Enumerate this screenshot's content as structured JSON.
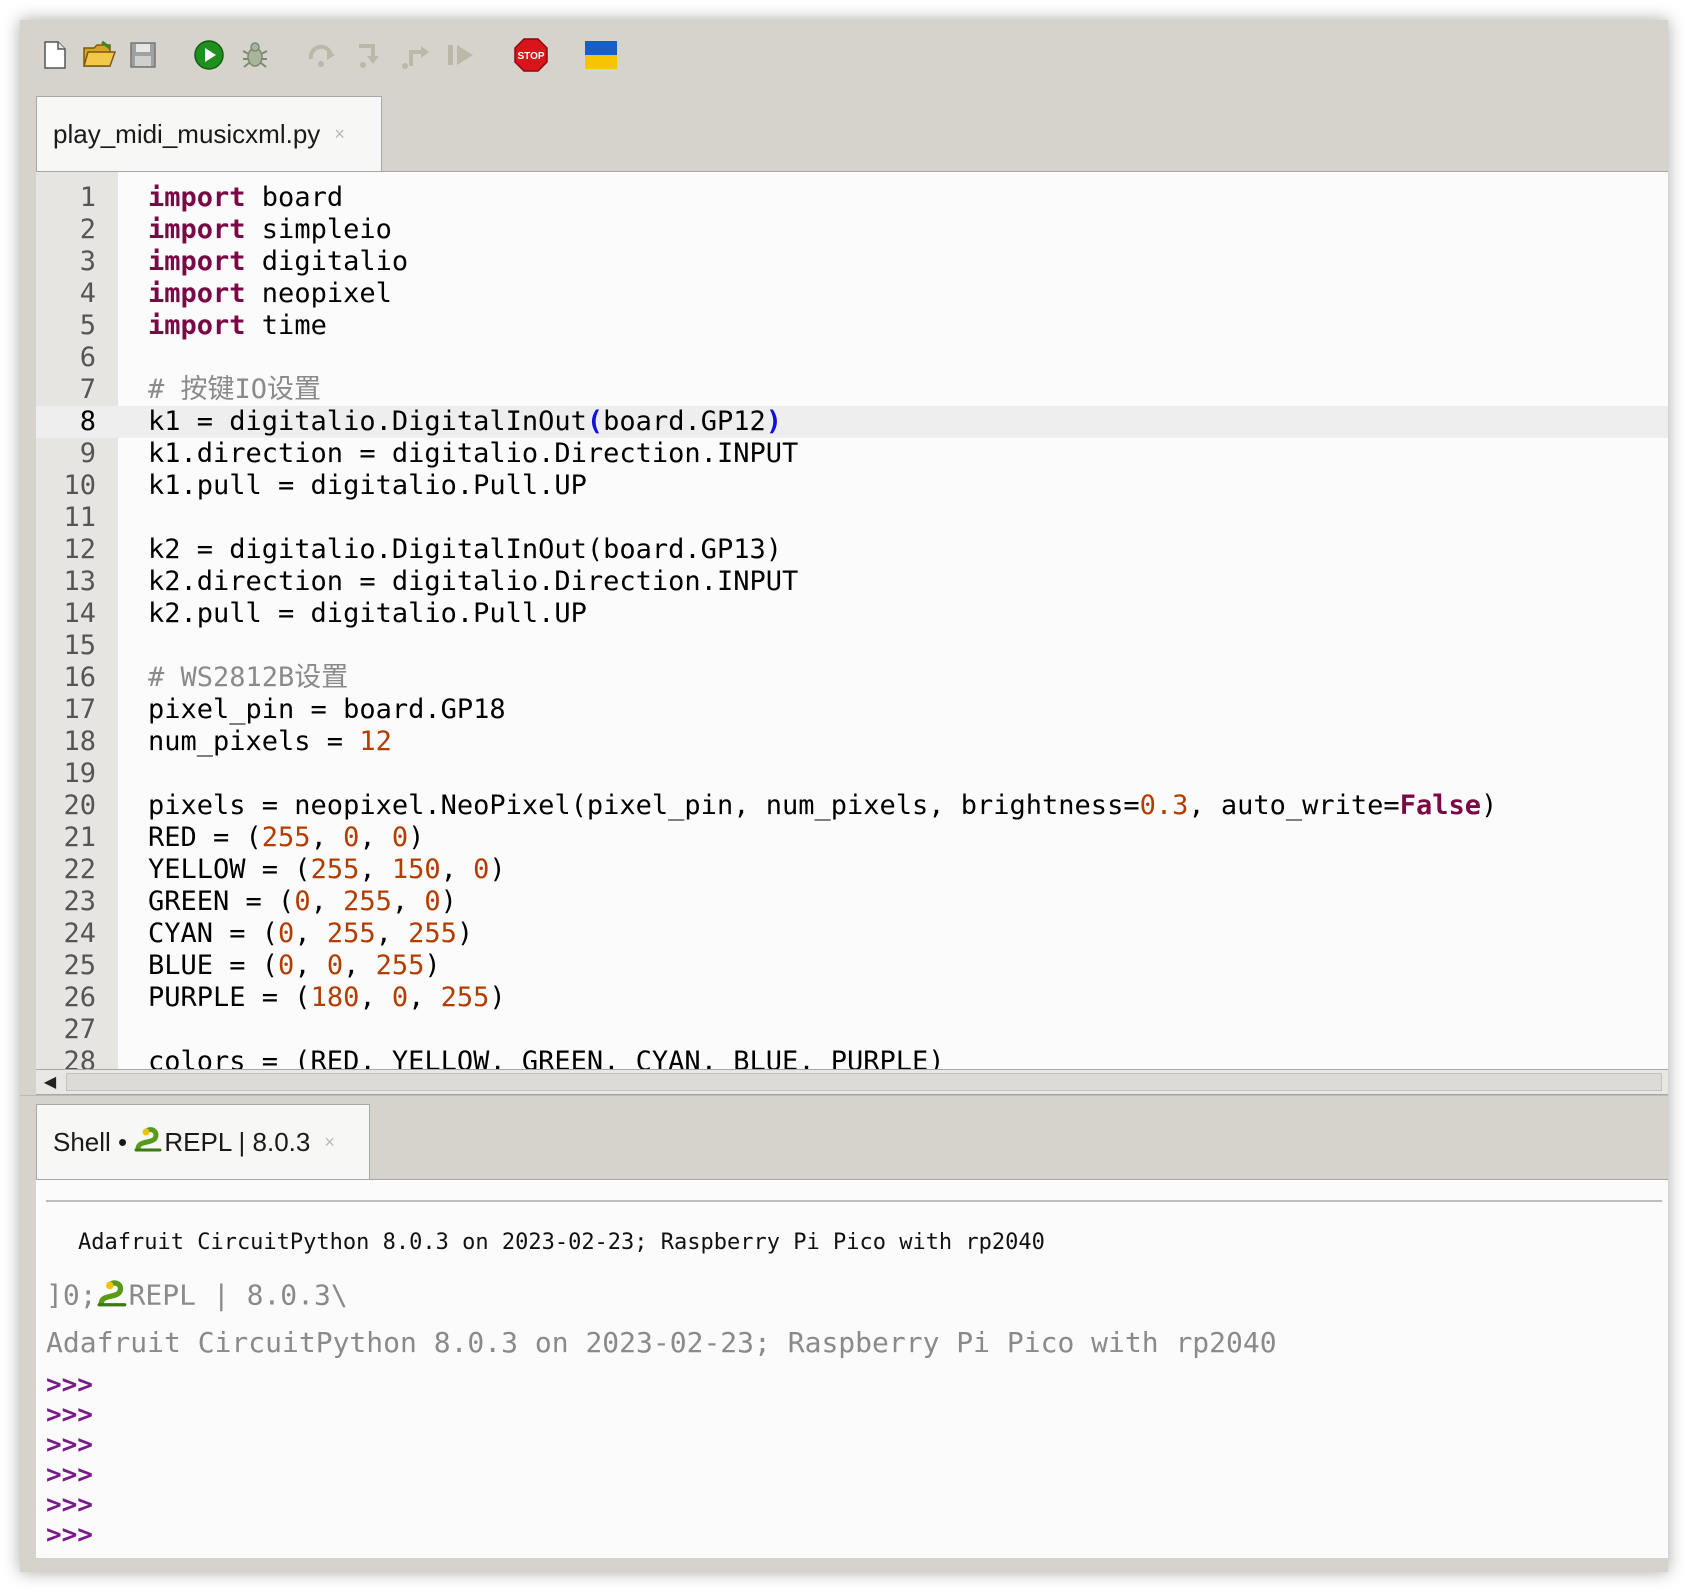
{
  "toolbar": {
    "buttons": [
      {
        "name": "new-file-icon"
      },
      {
        "name": "open-folder-icon"
      },
      {
        "name": "save-icon"
      },
      {
        "name": "run-icon",
        "color": "#1f8f1f"
      },
      {
        "name": "debug-bug-icon"
      },
      {
        "name": "step-over-icon"
      },
      {
        "name": "step-into-icon"
      },
      {
        "name": "step-out-icon"
      },
      {
        "name": "resume-icon"
      },
      {
        "name": "stop-icon",
        "label": "STOP",
        "color": "#d9141b"
      },
      {
        "name": "ukraine-flag-icon",
        "colors": [
          "#1560c4",
          "#f6c400"
        ]
      }
    ]
  },
  "editor": {
    "tab_label": "play_midi_musicxml.py",
    "tab_close": "×",
    "current_line": 8,
    "lines": [
      {
        "n": "1",
        "html": "<span class='t-kw'>import</span> board"
      },
      {
        "n": "2",
        "html": "<span class='t-kw'>import</span> simpleio"
      },
      {
        "n": "3",
        "html": "<span class='t-kw'>import</span> digitalio"
      },
      {
        "n": "4",
        "html": "<span class='t-kw'>import</span> neopixel"
      },
      {
        "n": "5",
        "html": "<span class='t-kw'>import</span> time"
      },
      {
        "n": "6",
        "html": ""
      },
      {
        "n": "7",
        "html": "<span class='t-cm'># 按键IO设置</span>"
      },
      {
        "n": "8",
        "html": "k1 = digitalio.DigitalInOut<span class='t-br'>(</span>board.GP12<span class='t-br'>)</span>"
      },
      {
        "n": "9",
        "html": "k1.direction = digitalio.Direction.INPUT"
      },
      {
        "n": "10",
        "html": "k1.pull = digitalio.Pull.UP"
      },
      {
        "n": "11",
        "html": ""
      },
      {
        "n": "12",
        "html": "k2 = digitalio.DigitalInOut(board.GP13)"
      },
      {
        "n": "13",
        "html": "k2.direction = digitalio.Direction.INPUT"
      },
      {
        "n": "14",
        "html": "k2.pull = digitalio.Pull.UP"
      },
      {
        "n": "15",
        "html": ""
      },
      {
        "n": "16",
        "html": "<span class='t-cm'># WS2812B设置</span>"
      },
      {
        "n": "17",
        "html": "pixel_pin = board.GP18"
      },
      {
        "n": "18",
        "html": "num_pixels = <span class='t-num'>12</span>"
      },
      {
        "n": "19",
        "html": ""
      },
      {
        "n": "20",
        "html": "pixels = neopixel.NeoPixel(pixel_pin, num_pixels, brightness=<span class='t-num'>0.3</span>, auto_write=<span class='t-kc'>False</span>)"
      },
      {
        "n": "21",
        "html": "RED = (<span class='t-num'>255</span>, <span class='t-num'>0</span>, <span class='t-num'>0</span>)"
      },
      {
        "n": "22",
        "html": "YELLOW = (<span class='t-num'>255</span>, <span class='t-num'>150</span>, <span class='t-num'>0</span>)"
      },
      {
        "n": "23",
        "html": "GREEN = (<span class='t-num'>0</span>, <span class='t-num'>255</span>, <span class='t-num'>0</span>)"
      },
      {
        "n": "24",
        "html": "CYAN = (<span class='t-num'>0</span>, <span class='t-num'>255</span>, <span class='t-num'>255</span>)"
      },
      {
        "n": "25",
        "html": "BLUE = (<span class='t-num'>0</span>, <span class='t-num'>0</span>, <span class='t-num'>255</span>)"
      },
      {
        "n": "26",
        "html": "PURPLE = (<span class='t-num'>180</span>, <span class='t-num'>0</span>, <span class='t-num'>255</span>)"
      },
      {
        "n": "27",
        "html": ""
      },
      {
        "n": "28",
        "html": "colors = (RED, YELLOW, GREEN, CYAN, BLUE, PURPLE)"
      }
    ]
  },
  "shell": {
    "tab_label_prefix": "Shell • ",
    "tab_label_suffix": "REPL | 8.0.3",
    "tab_close": "×",
    "banner": "Adafruit CircuitPython 8.0.3 on 2023-02-23; Raspberry Pi Pico with rp2040",
    "escape_prefix": "]0;",
    "escape_suffix": "REPL | 8.0.3\\",
    "info": "Adafruit CircuitPython 8.0.3 on 2023-02-23; Raspberry Pi Pico with rp2040",
    "prompts": [
      ">>>",
      ">>>",
      ">>>",
      ">>>",
      ">>>",
      ">>>"
    ]
  }
}
